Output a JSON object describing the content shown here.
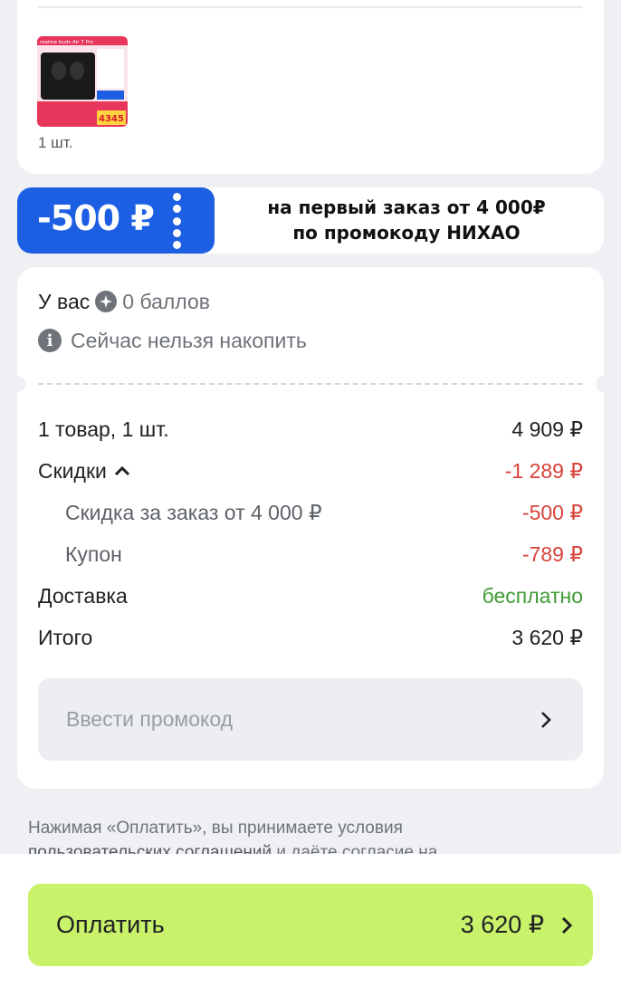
{
  "product": {
    "quantity_label": "1 шт.",
    "thumb_texts": [
      "realme buds Air 7 Pro",
      "4345"
    ]
  },
  "promo_banner": {
    "amount": "-500 ₽",
    "line1": "на первый заказ от 4 000₽",
    "line2": "по промокоду НИХАО"
  },
  "points": {
    "prefix": "У вас",
    "value": "0 баллов",
    "info": "Сейчас нельзя накопить"
  },
  "summary": {
    "rows": [
      {
        "label": "1 товар, 1 шт.",
        "value": "4 909 ₽"
      },
      {
        "label": "Скидки",
        "value": "-1 289 ₽"
      },
      {
        "label": "Скидка за заказ от 4 000 ₽",
        "value": "-500 ₽"
      },
      {
        "label": "Купон",
        "value": "-789 ₽"
      },
      {
        "label": "Доставка",
        "value": "бесплатно"
      },
      {
        "label": "Итого",
        "value": "3 620 ₽"
      }
    ]
  },
  "promo_input": {
    "placeholder": "Ввести промокод"
  },
  "legal": {
    "text": "Нажимая «Оплатить», вы принимаете условия",
    "link": "пользовательских соглашений",
    "tail": " и даёте согласие на"
  },
  "pay": {
    "label": "Оплатить",
    "amount": "3 620 ₽"
  },
  "colors": {
    "accent_blue": "#1d5fe3",
    "pay_green": "#c7f26a",
    "discount_red": "#d9423a",
    "free_green": "#3f9c35"
  }
}
